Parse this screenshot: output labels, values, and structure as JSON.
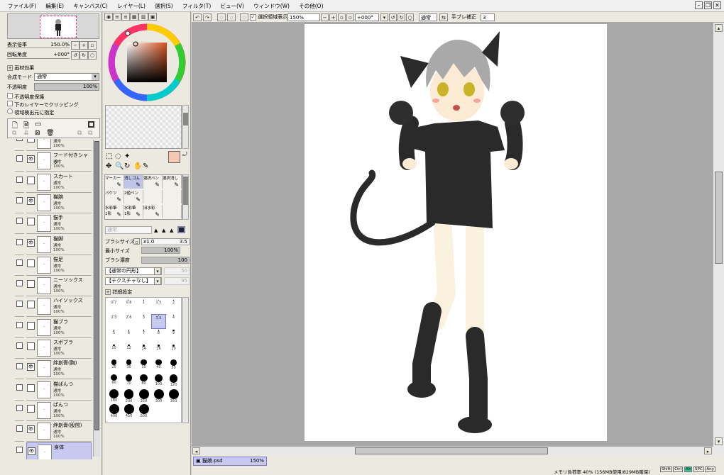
{
  "menu": {
    "items": [
      "ファイル(F)",
      "編集(E)",
      "キャンバス(C)",
      "レイヤー(L)",
      "選択(S)",
      "フィルタ(T)",
      "ビュー(V)",
      "ウィンドウ(W)",
      "その他(O)"
    ]
  },
  "navigator": {
    "zoom_label": "表示倍率",
    "zoom_value": "150.0%",
    "rotate_label": "回転角度",
    "rotate_value": "+000°"
  },
  "layer_panel": {
    "paper_effect": "画材効果",
    "blend_label": "合成モード",
    "blend_value": "通常",
    "opacity_label": "不透明度",
    "opacity_value": "100%",
    "opt1": "不透明度保護",
    "opt2": "下のレイヤーでクリッピング",
    "opt3": "領域検出元に指定",
    "layers": [
      {
        "name": "シャツ",
        "mode": "通常",
        "opacity": "100%",
        "visible": false
      },
      {
        "name": "フード付きシャツ",
        "mode": "通常",
        "opacity": "100%",
        "visible": true
      },
      {
        "name": "スカート",
        "mode": "通常",
        "opacity": "100%",
        "visible": false
      },
      {
        "name": "猫腕",
        "mode": "通常",
        "opacity": "100%",
        "visible": true
      },
      {
        "name": "猫手",
        "mode": "通常",
        "opacity": "100%",
        "visible": false
      },
      {
        "name": "猫脚",
        "mode": "通常",
        "opacity": "100%",
        "visible": true
      },
      {
        "name": "猫足",
        "mode": "通常",
        "opacity": "100%",
        "visible": false
      },
      {
        "name": "ニーソックス",
        "mode": "通常",
        "opacity": "100%",
        "visible": false
      },
      {
        "name": "ハイソックス",
        "mode": "通常",
        "opacity": "100%",
        "visible": false
      },
      {
        "name": "猫ブラ",
        "mode": "通常",
        "opacity": "100%",
        "visible": false
      },
      {
        "name": "スポブラ",
        "mode": "通常",
        "opacity": "100%",
        "visible": false
      },
      {
        "name": "絆創膏(胸)",
        "mode": "通常",
        "opacity": "100%",
        "visible": true
      },
      {
        "name": "猫ぱんつ",
        "mode": "通常",
        "opacity": "100%",
        "visible": false
      },
      {
        "name": "ぱんつ",
        "mode": "通常",
        "opacity": "100%",
        "visible": false
      },
      {
        "name": "絆創膏(股間)",
        "mode": "通常",
        "opacity": "100%",
        "visible": true
      },
      {
        "name": "身体",
        "mode": "",
        "opacity": "",
        "visible": true
      }
    ]
  },
  "tools": {
    "row1": [
      "マーカー",
      "消しゴム",
      "選択ペン",
      "選択消し"
    ],
    "row2": [
      "バケツ",
      "2値ペン",
      "",
      ""
    ],
    "row3": [
      "水彩筆",
      "水彩筆",
      "旧水彩",
      ""
    ],
    "row3_sub": [
      "1影",
      "1影",
      "",
      ""
    ],
    "blend_mode": "通常",
    "brush_size_label": "ブラシサイズ",
    "brush_size_mult": "x1.0",
    "brush_size_value": "3.5",
    "min_size_label": "最小サイズ",
    "min_size_value": "100%",
    "density_label": "ブラシ濃度",
    "density_value": "100",
    "shape_value": "【通常の円形】",
    "shape_num": "50",
    "texture_value": "【テクスチャなし】",
    "texture_num": "95",
    "detail_label": "詳細設定",
    "sizes": [
      "0.7",
      "0.8",
      "1",
      "1.5",
      "2",
      "2.3",
      "2.6",
      "3",
      "3.5",
      "4",
      "5",
      "6",
      "7",
      "8",
      "9",
      "10",
      "12",
      "14",
      "16",
      "20",
      "25",
      "30",
      "35",
      "40",
      "50",
      "60",
      "70",
      "80",
      "100",
      "120",
      "160",
      "200",
      "250",
      "300",
      "350",
      "400",
      "450",
      "500"
    ],
    "selected_size": "3.5"
  },
  "toolbar": {
    "show_selection": "選択領域表示",
    "zoom": "150%",
    "rotation": "+000°",
    "mode": "通常",
    "stabilizer_label": "手ブレ補正",
    "stabilizer_value": "3"
  },
  "document": {
    "tab_name": "猫娘.psd",
    "tab_zoom": "150%"
  },
  "status": {
    "memory": "メモリ負荷率 40% (156MB使用/829MB確保)",
    "keys": [
      "Shift",
      "Ctrl",
      "Alt",
      "SPC",
      "Any"
    ]
  },
  "colors": {
    "fg_color": "#f6c8b4",
    "bg_color": "#ffffff",
    "selected_layer": "#c8c8f0",
    "accent": "#8888cc"
  }
}
